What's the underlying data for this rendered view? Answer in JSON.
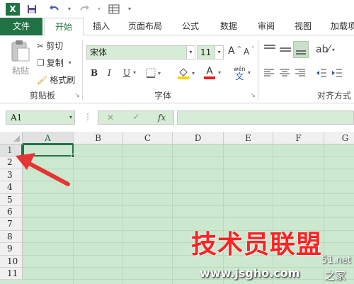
{
  "qat": {
    "app_icon": "excel-icon",
    "save_icon": "save-icon",
    "undo_icon": "undo-icon",
    "redo_icon": "redo-icon",
    "form_icon": "form-icon"
  },
  "tabs": [
    "文件",
    "开始",
    "插入",
    "页面布局",
    "公式",
    "数据",
    "审阅",
    "视图",
    "加载项"
  ],
  "active_tab": "开始",
  "ribbon": {
    "clipboard": {
      "paste_label": "粘贴",
      "cut_label": "剪切",
      "copy_label": "复制",
      "copy_arrow": "▾",
      "format_painter_label": "格式刷",
      "group_label": "剪贴板"
    },
    "font": {
      "font_name": "宋体",
      "font_size": "11",
      "grow_label": "A",
      "shrink_label": "A",
      "bold": "B",
      "italic": "I",
      "underline": "U",
      "font_color_label": "A",
      "phonetic_label": "wén",
      "phonetic_sub": "文",
      "group_label": "字体"
    },
    "alignment": {
      "group_label": "对齐方式"
    }
  },
  "formula_bar": {
    "name_box": "A1",
    "cancel_icon": "✕",
    "enter_icon": "✓",
    "fx_label": "fx",
    "value": ""
  },
  "grid": {
    "columns": [
      "A",
      "B",
      "C",
      "D",
      "E",
      "F",
      "G"
    ],
    "rows": [
      "1",
      "2",
      "3",
      "4",
      "5",
      "6",
      "7",
      "8",
      "9",
      "10",
      "11"
    ],
    "selected_cell": "A1"
  },
  "watermark": {
    "title": "技术员联盟",
    "site": "www.jsgho.com",
    "extra": "51.net",
    "extra2": "之家"
  },
  "colors": {
    "accent": "#217346",
    "cell_fill": "#cce8cf",
    "arrow": "#e53535",
    "watermark": "#ff2222"
  }
}
